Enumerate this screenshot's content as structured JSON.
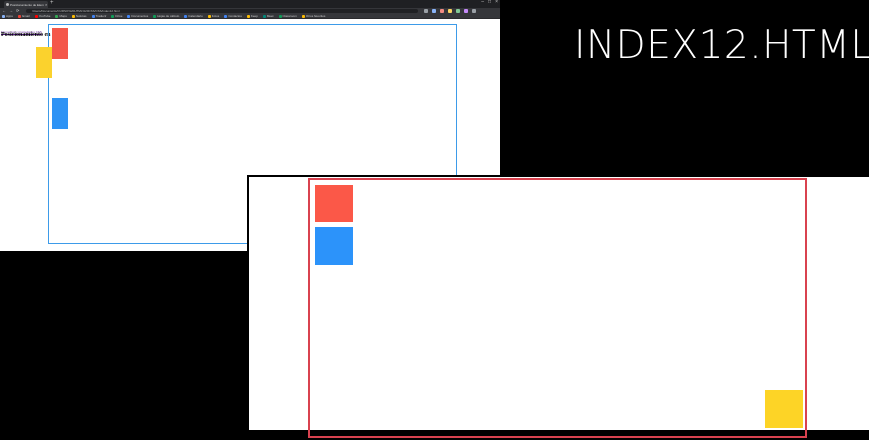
{
  "slide": {
    "title": "INDEX12.HTML"
  },
  "browser": {
    "tab_title": "Posicionamiento de Elementos",
    "tab_close": "×",
    "new_tab": "+",
    "window_controls": [
      "–",
      "□",
      "×"
    ],
    "nav": {
      "back": "←",
      "forward": "→",
      "reload": "⟳"
    },
    "address": "/Users/Documents/CURSO%20HTML%20CSS/CSS/index12.html",
    "bookmarks": [
      {
        "label": "Apps",
        "color": "#8ab4f8"
      },
      {
        "label": "Gmail",
        "color": "#ea4335"
      },
      {
        "label": "YouTube",
        "color": "#ff0000"
      },
      {
        "label": "Maps",
        "color": "#34a853"
      },
      {
        "label": "Noticias",
        "color": "#fbbc05"
      },
      {
        "label": "Traducir",
        "color": "#4285f4"
      },
      {
        "label": "Drive",
        "color": "#0f9d58"
      },
      {
        "label": "Documentos",
        "color": "#4285f4"
      },
      {
        "label": "Hojas de cálculo",
        "color": "#0f9d58"
      },
      {
        "label": "Calendario",
        "color": "#4285f4"
      },
      {
        "label": "Fotos",
        "color": "#fbbc05"
      },
      {
        "label": "Contactos",
        "color": "#4285f4"
      },
      {
        "label": "Keep",
        "color": "#fbbc05"
      },
      {
        "label": "Meet",
        "color": "#00897b"
      },
      {
        "label": "Classroom",
        "color": "#0f9d58"
      },
      {
        "label": "Otros favoritos",
        "color": "#fbbc05"
      }
    ],
    "ext_colors": [
      "#9aa0a6",
      "#8ab4f8",
      "#f28b82",
      "#fdd663",
      "#81c995",
      "#c58af9",
      "#9aa0a6"
    ],
    "page": {
      "link_text": "Elementos y propiedades CSS",
      "heading": "Posicionamiento en CSS"
    }
  },
  "colors": {
    "red": "#f4574a",
    "blue": "#2e93f5",
    "yellow": "#fbd22d",
    "container_blue": "#3d9be9",
    "container_red": "#d9424f"
  }
}
